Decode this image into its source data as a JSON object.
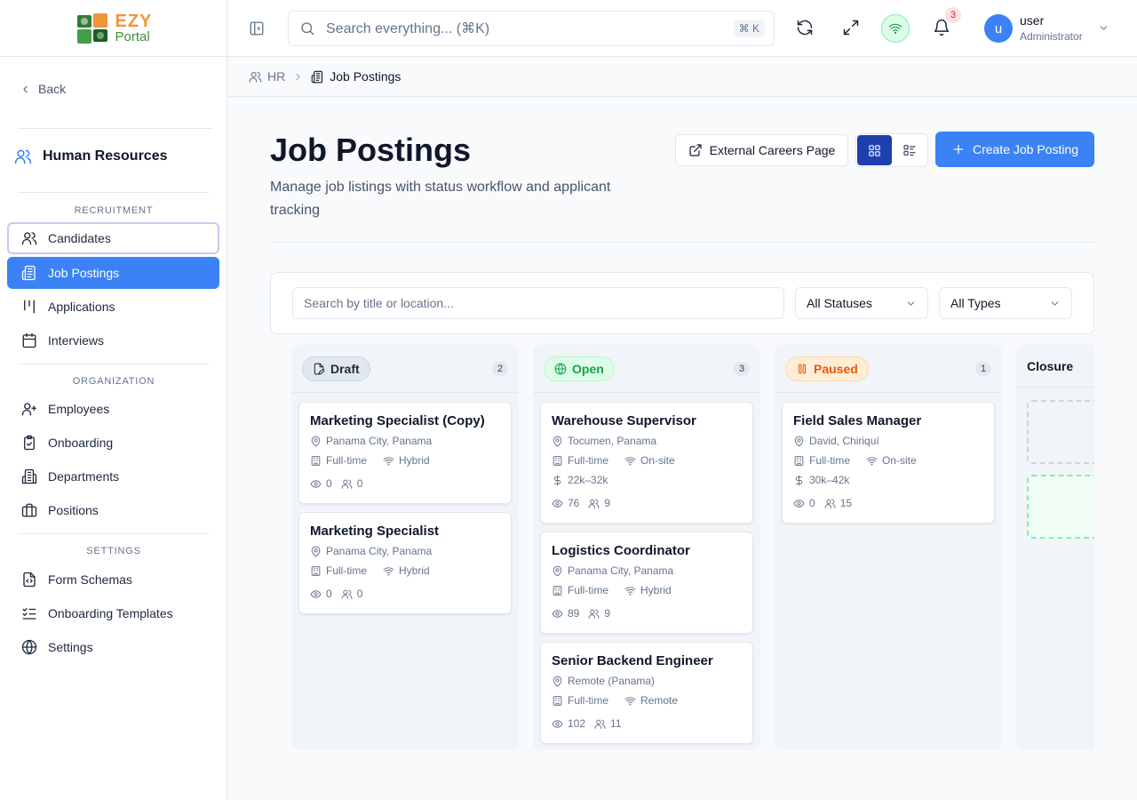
{
  "logo": {
    "line1": "EZY",
    "line2": "Portal"
  },
  "sidebar": {
    "back_label": "Back",
    "module_title": "Human Resources",
    "sections": {
      "recruitment": "RECRUITMENT",
      "organization": "ORGANIZATION",
      "settings": "SETTINGS"
    },
    "items": [
      {
        "label": "Candidates",
        "icon": "users-icon"
      },
      {
        "label": "Job Postings",
        "icon": "newspaper-icon",
        "active": true
      },
      {
        "label": "Applications",
        "icon": "kanban-icon"
      },
      {
        "label": "Interviews",
        "icon": "calendar-icon"
      },
      {
        "label": "Employees",
        "icon": "user-plus-icon"
      },
      {
        "label": "Onboarding",
        "icon": "clipboard-check-icon"
      },
      {
        "label": "Departments",
        "icon": "building-icon"
      },
      {
        "label": "Positions",
        "icon": "briefcase-icon"
      },
      {
        "label": "Form Schemas",
        "icon": "file-code-icon"
      },
      {
        "label": "Onboarding Templates",
        "icon": "list-checks-icon"
      },
      {
        "label": "Settings",
        "icon": "globe-icon"
      }
    ]
  },
  "topbar": {
    "search_placeholder": "Search everything... (⌘K)",
    "shortcut": "⌘ K",
    "notifications_count": "3",
    "user": {
      "initial": "u",
      "name": "user",
      "role": "Administrator"
    }
  },
  "breadcrumb": {
    "parent": "HR",
    "current": "Job Postings"
  },
  "header": {
    "title": "Job Postings",
    "subtitle": "Manage job listings with status workflow and applicant tracking",
    "external_btn": "External Careers Page",
    "create_btn": "Create Job Posting"
  },
  "filters": {
    "search_placeholder": "Search by title or location...",
    "status_value": "All Statuses",
    "type_value": "All Types"
  },
  "colors": {
    "accent": "#3b82f6",
    "draft_bg": "#e2e8f0",
    "open_bg": "#dcfce7",
    "open_fg": "#16a34a",
    "paused_bg": "#ffedd5",
    "paused_fg": "#ea580c"
  },
  "columns": [
    {
      "label": "Draft",
      "count": "2",
      "cards": [
        {
          "title": "Marketing Specialist (Copy)",
          "location": "Panama City, Panama",
          "type": "Full-time",
          "mode": "Hybrid",
          "views": "0",
          "applicants": "0"
        },
        {
          "title": "Marketing Specialist",
          "location": "Panama City, Panama",
          "type": "Full-time",
          "mode": "Hybrid",
          "views": "0",
          "applicants": "0"
        }
      ]
    },
    {
      "label": "Open",
      "count": "3",
      "cards": [
        {
          "title": "Warehouse Supervisor",
          "location": "Tocumen, Panama",
          "type": "Full-time",
          "mode": "On-site",
          "salary": "22k–32k",
          "views": "76",
          "applicants": "9"
        },
        {
          "title": "Logistics Coordinator",
          "location": "Panama City, Panama",
          "type": "Full-time",
          "mode": "Hybrid",
          "views": "89",
          "applicants": "9"
        },
        {
          "title": "Senior Backend Engineer",
          "location": "Remote (Panama)",
          "type": "Full-time",
          "mode": "Remote",
          "views": "102",
          "applicants": "11"
        }
      ]
    },
    {
      "label": "Paused",
      "count": "1",
      "cards": [
        {
          "title": "Field Sales Manager",
          "location": "David, Chiriquí",
          "type": "Full-time",
          "mode": "On-site",
          "salary": "30k–42k",
          "views": "0",
          "applicants": "15"
        }
      ]
    },
    {
      "label": "Closure"
    }
  ]
}
